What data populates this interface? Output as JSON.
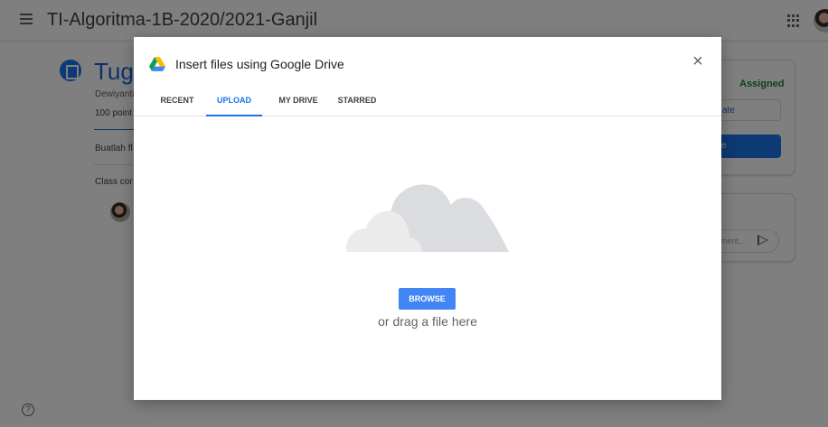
{
  "header": {
    "class_title": "TI-Algoritma-1B-2020/2021-Ganjil"
  },
  "assignment": {
    "title": "Tuga",
    "author": "Dewiyanti",
    "points": "100 point",
    "description": "Buatlah fl",
    "class_comments": "Class cor"
  },
  "side_panel": {
    "status": "Assigned",
    "create_label": "ate",
    "done_label": "e",
    "comment_placeholder": "ment..."
  },
  "help": {
    "glyph": "?"
  },
  "dialog": {
    "title": "Insert files using Google Drive",
    "close_glyph": "×",
    "tabs": [
      {
        "label": "RECENT",
        "active": false
      },
      {
        "label": "UPLOAD",
        "active": true
      },
      {
        "label": "MY DRIVE",
        "active": false
      },
      {
        "label": "STARRED",
        "active": false
      }
    ],
    "browse_label": "BROWSE",
    "drag_text": "or drag a file here"
  },
  "colors": {
    "accent": "#1a73e8",
    "browse_button": "#4285f4",
    "assigned_green": "#188038",
    "overlay": "rgba(0,0,0,0.5)"
  },
  "icons": [
    "menu-icon",
    "apps-icon",
    "assignment-icon",
    "send-icon",
    "help-icon",
    "google-drive-icon",
    "close-icon",
    "cloud-upload-icon"
  ]
}
